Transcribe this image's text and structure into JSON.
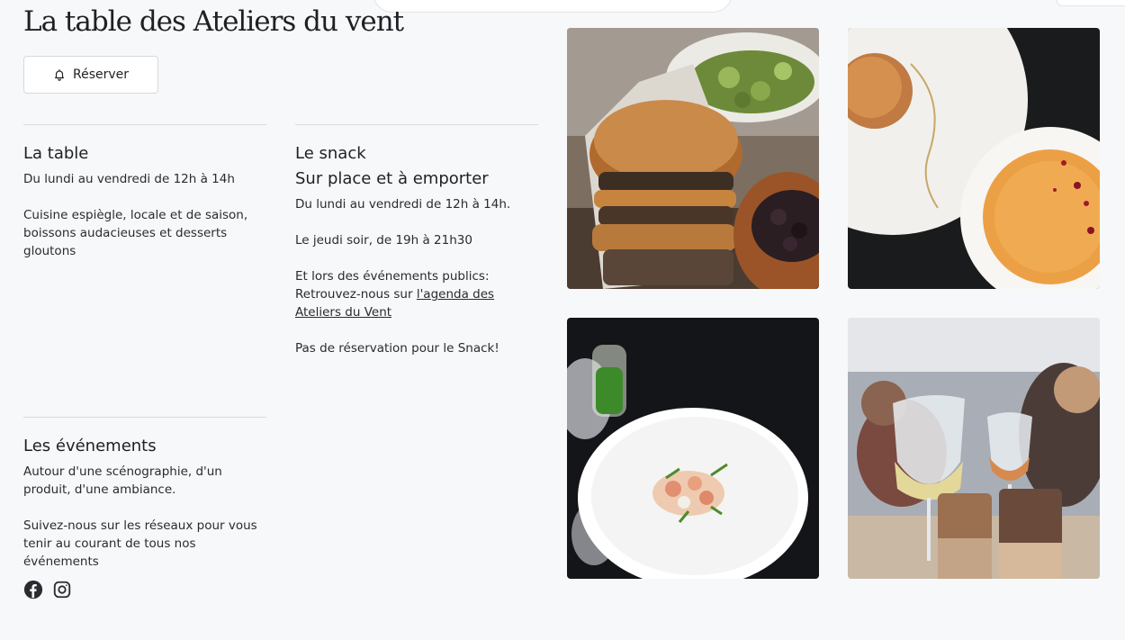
{
  "title": "La table des Ateliers du vent",
  "reserve_button": {
    "label": "Réserver",
    "icon": "bell-icon"
  },
  "sections": {
    "table": {
      "heading": "La table",
      "paragraphs": [
        "Du lundi au vendredi de 12h à 14h",
        "Cuisine espiègle, locale et de saison, boissons audacieuses et desserts gloutons"
      ]
    },
    "snack": {
      "heading_line1": "Le snack",
      "heading_line2": "Sur place et à emporter",
      "paragraphs": [
        "Du lundi au vendredi de 12h à 14h.",
        "Le jeudi soir, de 19h à 21h30",
        "Et lors des événements publics:",
        "Pas de réservation pour le Snack!"
      ],
      "agenda_prefix": "Retrouvez-nous sur ",
      "agenda_link": "l'agenda des Ateliers du Vent"
    },
    "events": {
      "heading": "Les événements",
      "paragraphs": [
        "Autour d'une scénographie, d'un produit, d'une ambiance.",
        "Suivez-nous sur les réseaux pour vous tenir au courant de tous nos événements"
      ],
      "social_icons": [
        "facebook-icon",
        "instagram-icon"
      ]
    }
  },
  "colors": {
    "background": "#f7f8fa",
    "text": "#1f2024",
    "divider": "#d9dadf"
  }
}
